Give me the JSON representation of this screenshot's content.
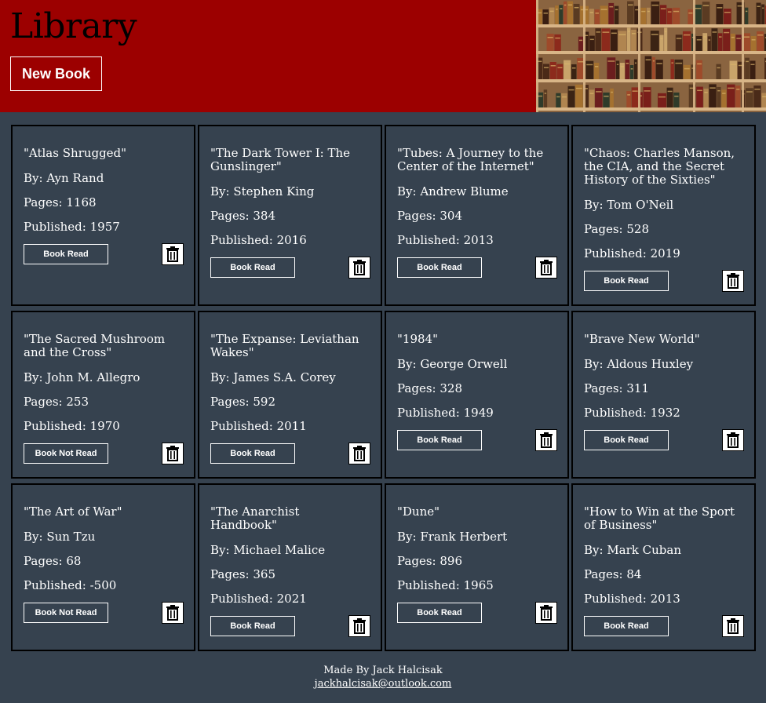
{
  "header": {
    "title": "Library",
    "new_book_label": "New Book",
    "accent_color": "#9c0000"
  },
  "books": [
    {
      "title": "\"Atlas Shrugged\"",
      "author": "By: Ayn Rand",
      "pages": "Pages: 1168",
      "published": "Published: 1957",
      "status": "Book Read"
    },
    {
      "title": "\"The Dark Tower I: The Gunslinger\"",
      "author": "By: Stephen King",
      "pages": "Pages: 384",
      "published": "Published: 2016",
      "status": "Book Read"
    },
    {
      "title": "\"Tubes: A Journey to the Center of the Internet\"",
      "author": "By: Andrew Blume",
      "pages": "Pages: 304",
      "published": "Published: 2013",
      "status": "Book Read"
    },
    {
      "title": "\"Chaos: Charles Manson, the CIA, and the Secret History of the Sixties\"",
      "author": "By: Tom O'Neil",
      "pages": "Pages: 528",
      "published": "Published: 2019",
      "status": "Book Read"
    },
    {
      "title": "\"The Sacred Mushroom and the Cross\"",
      "author": "By: John M. Allegro",
      "pages": "Pages: 253",
      "published": "Published: 1970",
      "status": "Book Not Read"
    },
    {
      "title": "\"The Expanse: Leviathan Wakes\"",
      "author": "By: James S.A. Corey",
      "pages": "Pages: 592",
      "published": "Published: 2011",
      "status": "Book Read"
    },
    {
      "title": "\"1984\"",
      "author": "By: George Orwell",
      "pages": "Pages: 328",
      "published": "Published: 1949",
      "status": "Book Read"
    },
    {
      "title": "\"Brave New World\"",
      "author": "By: Aldous Huxley",
      "pages": "Pages: 311",
      "published": "Published: 1932",
      "status": "Book Read"
    },
    {
      "title": "\"The Art of War\"",
      "author": "By: Sun Tzu",
      "pages": "Pages: 68",
      "published": "Published: -500",
      "status": "Book Not Read"
    },
    {
      "title": "\"The Anarchist Handbook\"",
      "author": "By: Michael Malice",
      "pages": "Pages: 365",
      "published": "Published: 2021",
      "status": "Book Read"
    },
    {
      "title": "\"Dune\"",
      "author": "By: Frank Herbert",
      "pages": "Pages: 896",
      "published": "Published: 1965",
      "status": "Book Read"
    },
    {
      "title": "\"How to Win at the Sport of Business\"",
      "author": "By: Mark Cuban",
      "pages": "Pages: 84",
      "published": "Published: 2013",
      "status": "Book Read"
    }
  ],
  "icons": {
    "delete": "trash-icon",
    "header_image": "bookshelf-image"
  },
  "footer": {
    "credit": "Made By Jack Halcisak",
    "email": "jackhalcisak@outlook.com"
  }
}
